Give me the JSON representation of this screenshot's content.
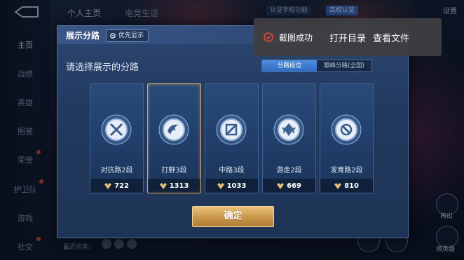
{
  "nav": {
    "items": [
      {
        "label": "主页",
        "active": true
      },
      {
        "label": "战绩",
        "active": false
      },
      {
        "label": "英雄",
        "active": false
      },
      {
        "label": "图鉴",
        "active": false
      },
      {
        "label": "荣誉",
        "active": false
      },
      {
        "label": "护卫队",
        "active": false
      },
      {
        "label": "游戏",
        "active": false
      },
      {
        "label": "社交",
        "active": false
      }
    ]
  },
  "top": {
    "tab_profile": "个人主页",
    "tab_esports": "电竞生涯",
    "chip_left": "认证学校功能",
    "chip_right": "高校认证",
    "settings": "设置"
  },
  "modal": {
    "title": "展示分路",
    "priority_label": "优先显示",
    "prompt": "请选择展示的分路",
    "toggle": [
      {
        "label": "分路段位",
        "on": true
      },
      {
        "label": "巅峰分路(全国)",
        "on": false
      }
    ],
    "lanes": [
      {
        "name": "对抗路2段",
        "score": "722",
        "icon": "sword-lane-icon",
        "selected": false
      },
      {
        "name": "打野3段",
        "score": "1313",
        "icon": "jungle-lane-icon",
        "selected": true
      },
      {
        "name": "中路3段",
        "score": "1033",
        "icon": "mid-lane-icon",
        "selected": false
      },
      {
        "name": "游走2段",
        "score": "669",
        "icon": "roam-lane-icon",
        "selected": false
      },
      {
        "name": "发育路2段",
        "score": "810",
        "icon": "farm-lane-icon",
        "selected": false
      }
    ],
    "confirm": "确定"
  },
  "toast": {
    "message": "截图成功",
    "open_dir": "打开目录",
    "view_file": "查看文件"
  },
  "bottom": {
    "recent": "最近访客:",
    "right_label_1": "再出",
    "right_label_2": "换英雄"
  },
  "colors": {
    "accent_blue": "#2f6bc2",
    "gold": "#c9974a",
    "toast_bg": "#3e3e42",
    "toast_icon": "#e3463b"
  }
}
